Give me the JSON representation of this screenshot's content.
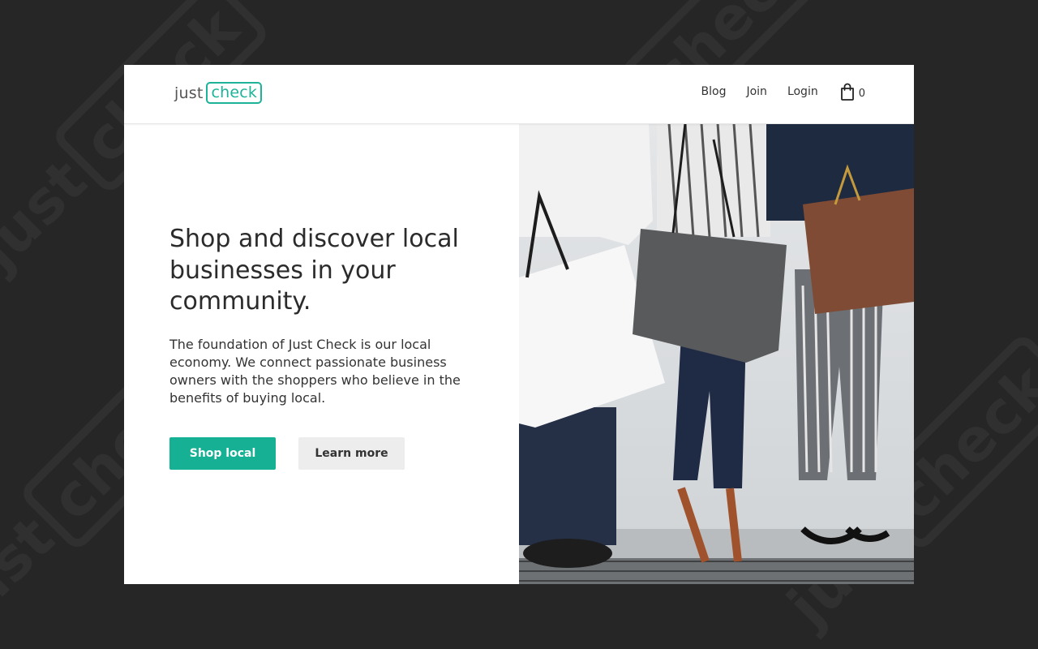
{
  "brand": {
    "logo_word1": "just",
    "logo_word2": "check",
    "accent_color": "#16b194"
  },
  "nav": {
    "items": [
      {
        "label": "Blog"
      },
      {
        "label": "Join"
      },
      {
        "label": "Login"
      }
    ],
    "cart_icon": "shopping-bag-icon",
    "cart_count": "0"
  },
  "hero": {
    "headline": "Shop and discover local businesses in your community.",
    "description": "The foundation of Just Check is our local economy. We connect passionate business owners with the shoppers who believe in the benefits of buying local.",
    "primary_button": "Shop local",
    "secondary_button": "Learn more"
  }
}
